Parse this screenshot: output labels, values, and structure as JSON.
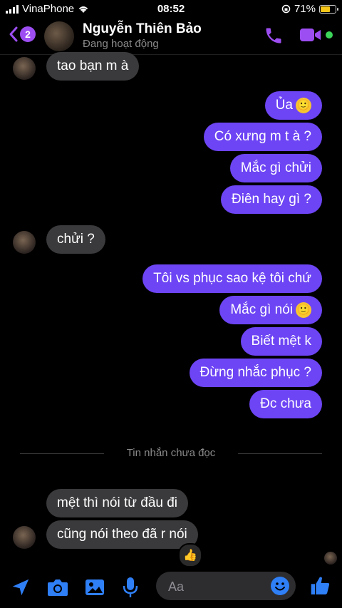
{
  "status_bar": {
    "carrier": "VinaPhone",
    "time": "08:52",
    "battery": "71%",
    "battery_level": 0.71
  },
  "header": {
    "back_badge": "2",
    "name": "Nguyễn Thiên Bảo",
    "status": "Đang hoạt động"
  },
  "messages": [
    {
      "side": "in",
      "text": "tao bạn m à"
    },
    {
      "side": "out",
      "text": "Ủa",
      "emoji": "🙂"
    },
    {
      "side": "out",
      "text": "Có xưng m t à ?"
    },
    {
      "side": "out",
      "text": "Mắc gì chửi"
    },
    {
      "side": "out",
      "text": "Điên hay gì ?"
    },
    {
      "side": "in",
      "text": "chửi ?"
    },
    {
      "side": "out",
      "text": "Tôi vs phục sao kệ tôi chứ"
    },
    {
      "side": "out",
      "text": "Mắc gì nói",
      "emoji": "🙂"
    },
    {
      "side": "out",
      "text": "Biết mệt k"
    },
    {
      "side": "out",
      "text": "Đừng nhắc phục ?"
    },
    {
      "side": "out",
      "text": "Đc chưa"
    },
    {
      "side": "in",
      "text": "mệt thì nói từ đầu đi"
    },
    {
      "side": "in",
      "text": "cũng nói theo đã r nói"
    }
  ],
  "unread_divider": "Tin nhắn chưa đọc",
  "reaction": "👍",
  "composer": {
    "placeholder": "Aa"
  },
  "colors": {
    "accent": "#9d4ef2",
    "outgoing": "#6d45f4",
    "incoming": "#3a3a3c",
    "composer_icons": "#2f7ff6"
  }
}
